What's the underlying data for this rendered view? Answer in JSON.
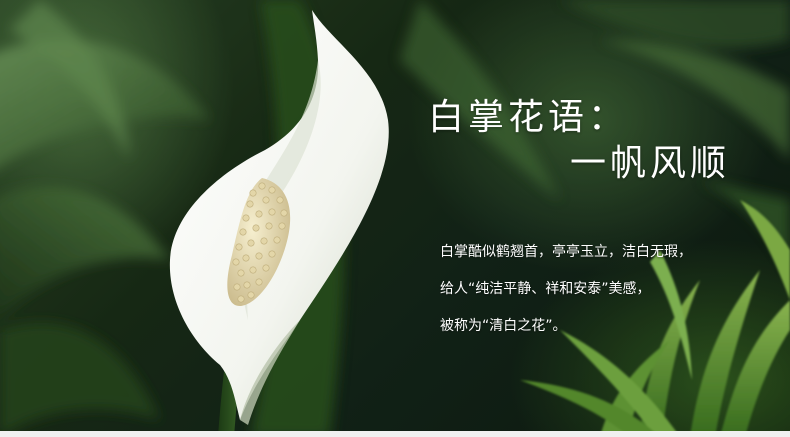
{
  "title": {
    "line1": "白掌花语：",
    "line2": "一帆风顺"
  },
  "description": {
    "lines": [
      "白掌酷似鹤翘首，亭亭玉立，洁白无瑕，",
      "给人“纯洁平静、祥和安泰”美感，",
      "被称为“清白之花”。"
    ]
  },
  "colors": {
    "text": "#ffffff",
    "spathe": "#f7f8f4",
    "spadix": "#e9dfb8",
    "foliage": "#3f6b2e"
  }
}
